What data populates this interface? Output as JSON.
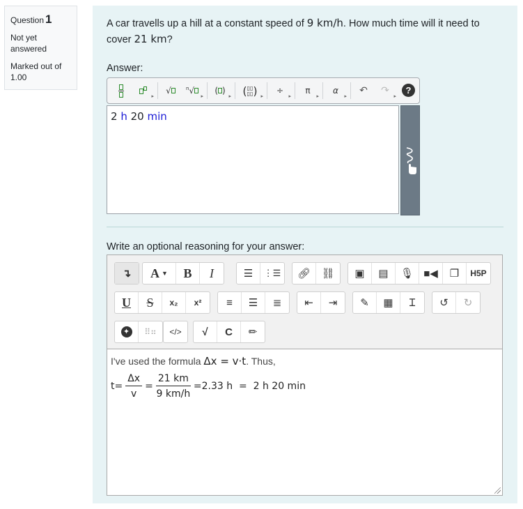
{
  "question_info": {
    "label": "Question",
    "number": "1",
    "state": "Not yet answered",
    "grade": "Marked out of 1.00"
  },
  "question": {
    "text_before": "A car travells up a hill at a constant speed of ",
    "speed": "9 km/h",
    "text_mid": ". How much time will it need to cover ",
    "distance": "21 km",
    "text_after": "?"
  },
  "answer": {
    "label": "Answer:",
    "hours_value": "2",
    "hours_unit": "h",
    "minutes_value": "20",
    "minutes_unit": "min"
  },
  "math_toolbar": {
    "pi_symbol": "π",
    "alpha_symbol": "α",
    "divide_symbol": "÷",
    "help_symbol": "?"
  },
  "reasoning": {
    "label": "Write an optional reasoning for your answer:",
    "intro_text": "I've used the formula ",
    "formula": "Δx = v·t",
    "intro_end": ". Thus,",
    "eq_lhs": "t=",
    "frac1_num": "Δx",
    "frac1_den": "v",
    "eq_sign": "=",
    "frac2_num": "21 km",
    "frac2_den": "9 km/h",
    "result": "=2.33 h  =  2 h 20 min"
  },
  "rte_toolbar": {
    "font_label": "A",
    "bold_label": "B",
    "italic_label": "I",
    "underline_label": "U",
    "strike_label": "S",
    "subscript_label": "x₂",
    "superscript_label": "x²",
    "h5p_label": "H5P",
    "code_label": "</>"
  }
}
